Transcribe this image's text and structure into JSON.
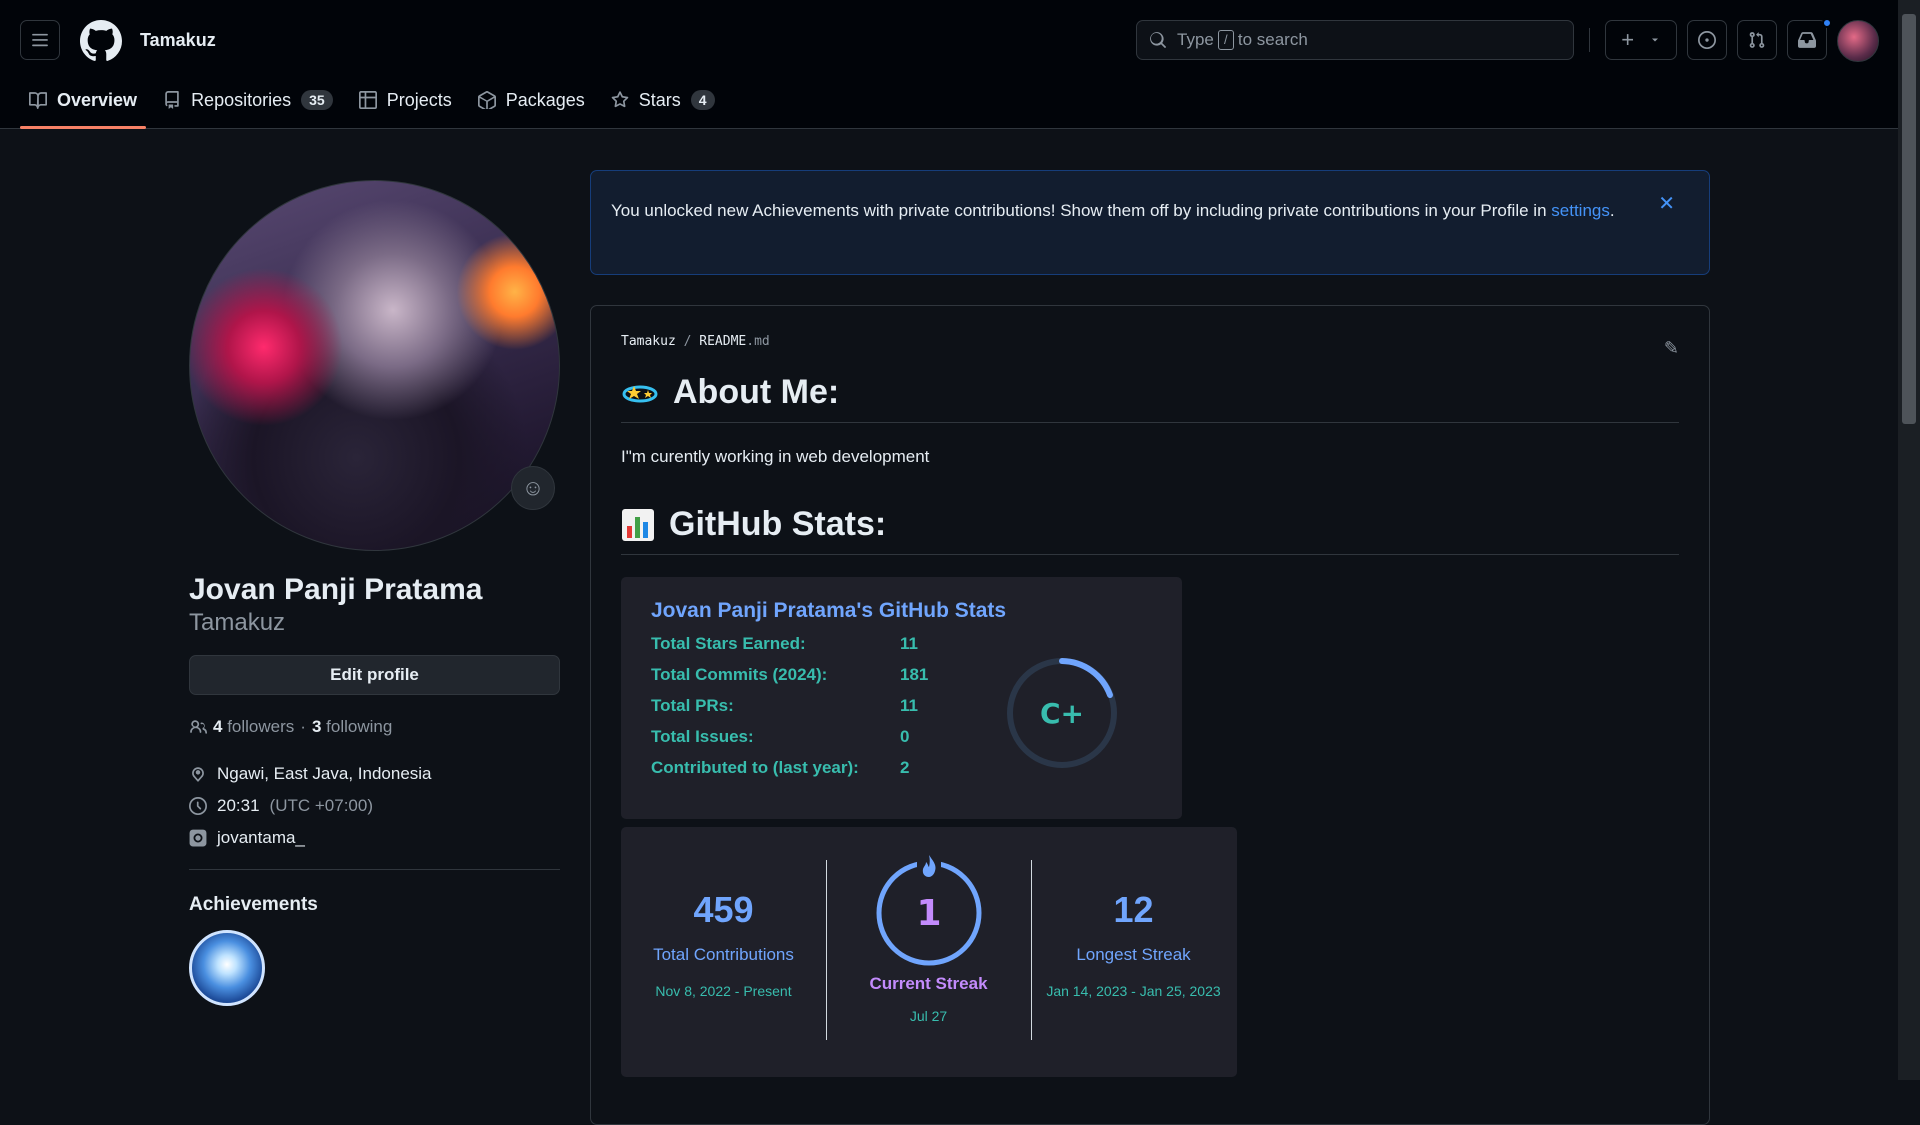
{
  "header": {
    "username": "Tamakuz",
    "search_placeholder_pre": "Type",
    "search_slash": "/",
    "search_placeholder_post": "to search"
  },
  "tabs": [
    {
      "label": "Overview",
      "count": null
    },
    {
      "label": "Repositories",
      "count": "35"
    },
    {
      "label": "Projects",
      "count": null
    },
    {
      "label": "Packages",
      "count": null
    },
    {
      "label": "Stars",
      "count": "4"
    }
  ],
  "profile": {
    "fullname": "Jovan Panji Pratama",
    "login": "Tamakuz",
    "edit_label": "Edit profile",
    "followers_count": "4",
    "followers_label": "followers",
    "dot": "·",
    "following_count": "3",
    "following_label": "following",
    "location": "Ngawi, East Java, Indonesia",
    "time": "20:31",
    "tz": "(UTC +07:00)",
    "instagram": "jovantama_",
    "achievements_title": "Achievements"
  },
  "flash": {
    "text": "You unlocked new Achievements with private contributions! Show them off by including private contributions in your Profile in",
    "link": "settings",
    "end": "."
  },
  "readme": {
    "owner": "Tamakuz",
    "slash": "/",
    "file": "README",
    "ext": ".md",
    "about_heading": "About Me:",
    "about_text": "I\"m curently working in web development",
    "stats_heading": "GitHub Stats:"
  },
  "stats_card": {
    "title": "Jovan Panji Pratama's GitHub Stats",
    "rows": [
      {
        "label": "Total Stars Earned:",
        "value": "11"
      },
      {
        "label": "Total Commits (2024):",
        "value": "181"
      },
      {
        "label": "Total PRs:",
        "value": "11"
      },
      {
        "label": "Total Issues:",
        "value": "0"
      },
      {
        "label": "Contributed to (last year):",
        "value": "2"
      }
    ],
    "rank": "C+"
  },
  "streak_card": {
    "total": "459",
    "total_label": "Total Contributions",
    "total_range": "Nov 8, 2022 - Present",
    "current": "1",
    "current_label": "Current Streak",
    "current_date": "Jul 27",
    "longest": "12",
    "longest_label": "Longest Streak",
    "longest_range": "Jan 14, 2023 - Jan 25, 2023"
  },
  "colors": {
    "accent_link": "#4493f8",
    "stat_title": "#70a5fd",
    "stat_text": "#38bdae",
    "tab_underline": "#f78166"
  }
}
